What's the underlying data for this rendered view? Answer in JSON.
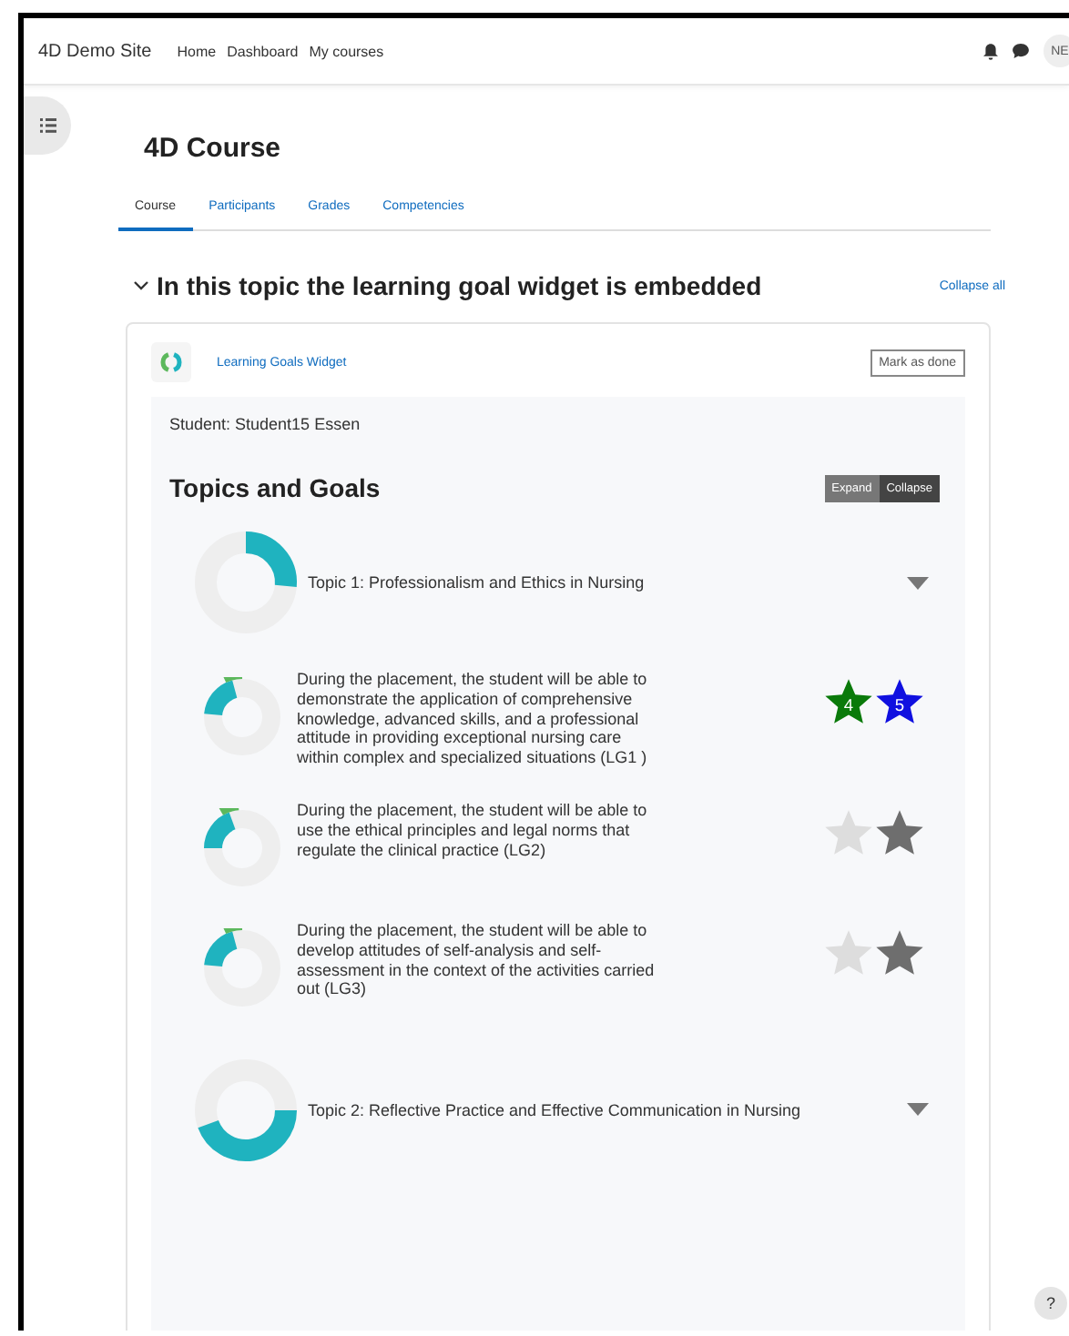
{
  "navbar": {
    "site_name": "4D Demo Site",
    "links": [
      "Home",
      "Dashboard",
      "My courses"
    ],
    "avatar": "NE"
  },
  "course": {
    "title": "4D Course",
    "tabs": [
      {
        "label": "Course",
        "selected": true
      },
      {
        "label": "Participants",
        "selected": false
      },
      {
        "label": "Grades",
        "selected": false
      },
      {
        "label": "Competencies",
        "selected": false
      }
    ]
  },
  "section": {
    "title": "In this topic the learning goal widget is embedded",
    "expanded": true,
    "collapse_all": "Collapse all"
  },
  "activity": {
    "name": "Learning Goals Widget",
    "button": "Mark as done"
  },
  "widget": {
    "student": "Student: Student15 Essen",
    "heading": "Topics and Goals",
    "toggle": [
      {
        "label": "Expand",
        "selected": false
      },
      {
        "label": "Collapse",
        "selected": true
      }
    ],
    "items": [
      {
        "kind": "topic",
        "text": "Topic 1: Professionalism and Ethics in Nursing"
      },
      {
        "kind": "goal",
        "text": "During the placement, the student will be able to demonstrate the application of comprehensive knowledge, advanced skills, and a professional attitude in providing exceptional nursing care within complex and specialized situations (LG1 )",
        "stars": [
          {
            "label": "4",
            "color": "#0a7a0a"
          },
          {
            "label": "5",
            "color": "#1010e0"
          }
        ]
      },
      {
        "kind": "goal",
        "text": "During the placement, the student will be able to use the ethical principles and legal norms that regulate the clinical practice (LG2)",
        "stars": [
          {
            "color": "#dddddd"
          },
          {
            "color": "#6e6e6e"
          }
        ]
      },
      {
        "kind": "goal",
        "text": "During the placement, the student will be able to develop attitudes of self-analysis and self-assessment in the context of the activities carried out (LG3)",
        "stars": [
          {
            "color": "#dddddd"
          },
          {
            "color": "#6e6e6e"
          }
        ]
      },
      {
        "kind": "topic",
        "text": "Topic 2: Reflective Practice and Effective Communication in Nursing"
      }
    ]
  },
  "help": "?"
}
